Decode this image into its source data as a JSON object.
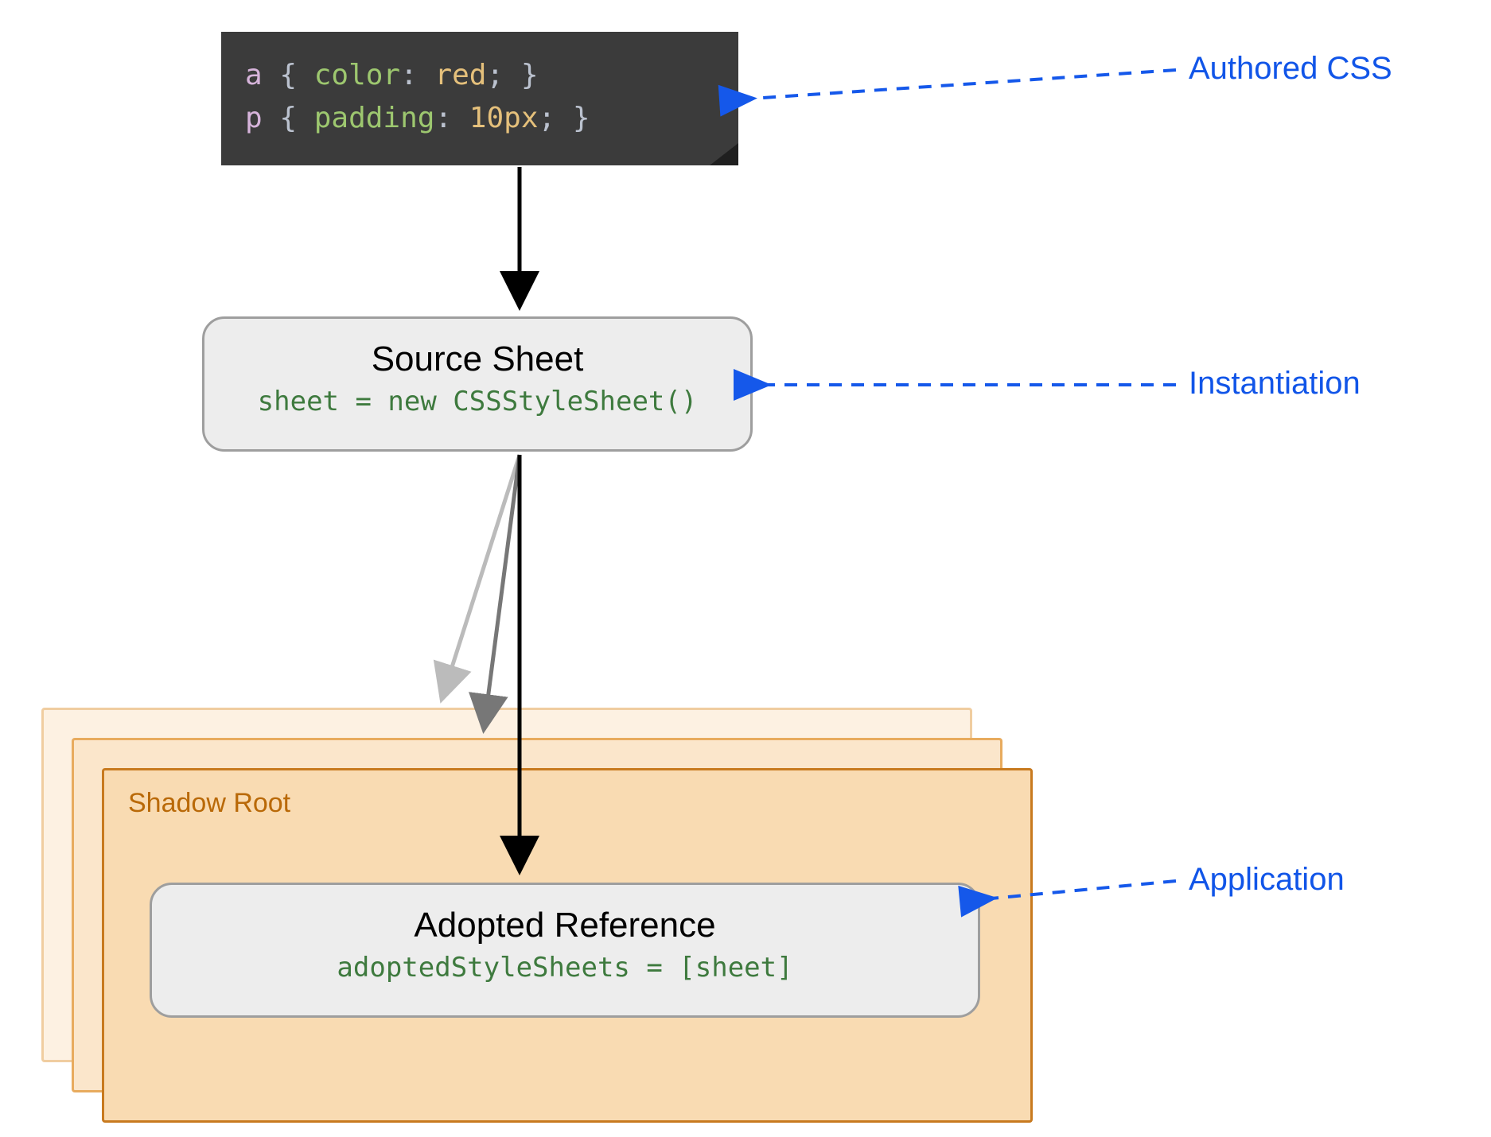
{
  "code": {
    "rule1": {
      "selector": "a",
      "prop": "color",
      "value": "red"
    },
    "rule2": {
      "selector": "p",
      "prop": "padding",
      "value": "10px"
    }
  },
  "source_box": {
    "title": "Source Sheet",
    "code": "sheet = new CSSStyleSheet()"
  },
  "shadow_root": {
    "label": "Shadow Root"
  },
  "adopted_box": {
    "title": "Adopted Reference",
    "code": "adoptedStyleSheets = [sheet]"
  },
  "annotations": {
    "authored": "Authored CSS",
    "instantiation": "Instantiation",
    "application": "Application"
  }
}
